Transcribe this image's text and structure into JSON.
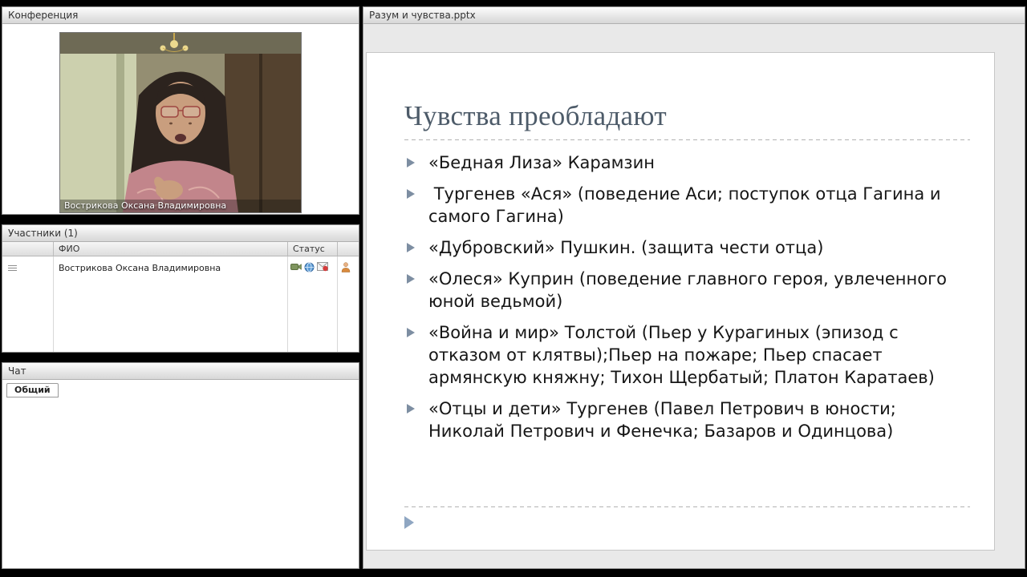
{
  "conference": {
    "title": "Конференция",
    "video_caption": "Вострикова Оксана Владимировна"
  },
  "participants": {
    "title": "Участники (1)",
    "columns": {
      "name": "ФИО",
      "status": "Статус"
    },
    "rows": [
      {
        "name": "Вострикова Оксана Владимировна",
        "status_icons": [
          "webcam",
          "network",
          "mail"
        ],
        "role_icon": "user"
      }
    ]
  },
  "chat": {
    "title": "Чат",
    "tab": "Общий"
  },
  "presentation": {
    "title": "Разум и чувства.pptx",
    "slide": {
      "title": "Чувства преобладают",
      "bullets": [
        "«Бедная Лиза» Карамзин",
        " Тургенев «Ася» (поведение Аси; поступок отца Гагина и самого Гагина)",
        "«Дубровский» Пушкин. (защита чести отца)",
        "«Олеся» Куприн (поведение главного героя, увлеченного юной ведьмой)",
        "«Война и мир» Толстой (Пьер у Курагиных (эпизод с отказом от клятвы);Пьер на пожаре; Пьер спасает армянскую княжну; Тихон Щербатый; Платон Каратаев)",
        "«Отцы и дети» Тургенев (Павел Петрович в юности; Николай Петрович и Фенечка; Базаров и Одинцова)"
      ]
    }
  },
  "icons": {
    "bullet_marker": "right-triangle",
    "drag_handle": "menu-lines",
    "colors": {
      "slide_title": "#4d5b69",
      "bullet_marker": "#7d8ea2",
      "footer_marker": "#8fa6c2"
    }
  }
}
